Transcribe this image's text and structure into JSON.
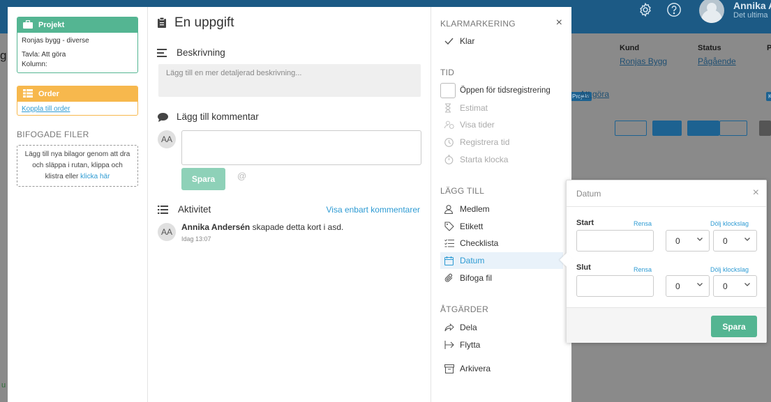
{
  "background": {
    "user": {
      "name": "Annika A",
      "subtitle": "Det ultima"
    },
    "columns": {
      "kund_label": "Kund",
      "kund_value": "Ronjas Bygg",
      "status_label": "Status",
      "status_value": "Pågående",
      "extra_label": "P"
    },
    "tag_label": "Projekt",
    "tag_k": "K",
    "board_link": "Att göra",
    "left_fragments": [
      "g",
      "u"
    ]
  },
  "left": {
    "project_card": {
      "title": "Projekt",
      "name": "Ronjas bygg - diverse",
      "board": "Tavla: Att göra",
      "column": "Kolumn:"
    },
    "order_card": {
      "title": "Order",
      "link": "Koppla till order"
    },
    "attached_title": "BIFOGADE FILER",
    "drop_text": "Lägg till nya bilagor genom att dra och släppa i rutan, klippa och klistra eller",
    "drop_link": "klicka här"
  },
  "main": {
    "title": "En uppgift",
    "description_heading": "Beskrivning",
    "description_placeholder": "Lägg till en mer detaljerad beskrivning...",
    "comment_heading": "Lägg till kommentar",
    "avatar_initials": "AA",
    "save_label": "Spara",
    "at_symbol": "@",
    "activity_heading": "Aktivitet",
    "activity_filter": "Visa enbart kommentarer",
    "activity": {
      "user": "Annika Andersén",
      "action": "skapade detta kort i asd.",
      "time": "Idag 13:07"
    }
  },
  "right": {
    "close": "×",
    "done_title": "KLARMARKERING",
    "done_item": "Klar",
    "time_title": "TID",
    "time_items": [
      "Öppen för tidsregistrering",
      "Estimat",
      "Visa tider",
      "Registrera tid",
      "Starta klocka"
    ],
    "add_title": "LÄGG TILL",
    "add_items": [
      "Medlem",
      "Etikett",
      "Checklista",
      "Datum",
      "Bifoga fil"
    ],
    "actions_title": "ÅTGÄRDER",
    "action_items": [
      "Dela",
      "Flytta",
      "Arkivera"
    ]
  },
  "date_popup": {
    "title": "Datum",
    "close": "×",
    "start_label": "Start",
    "end_label": "Slut",
    "clear_label": "Rensa",
    "hide_time_label": "Dölj klockslag",
    "hour_value": "0",
    "minute_value": "0",
    "save_label": "Spara"
  },
  "colors": {
    "green": "#54b592",
    "orange": "#f7b84d",
    "link_blue": "#2e9bd3",
    "topbar": "#1c5a85"
  }
}
